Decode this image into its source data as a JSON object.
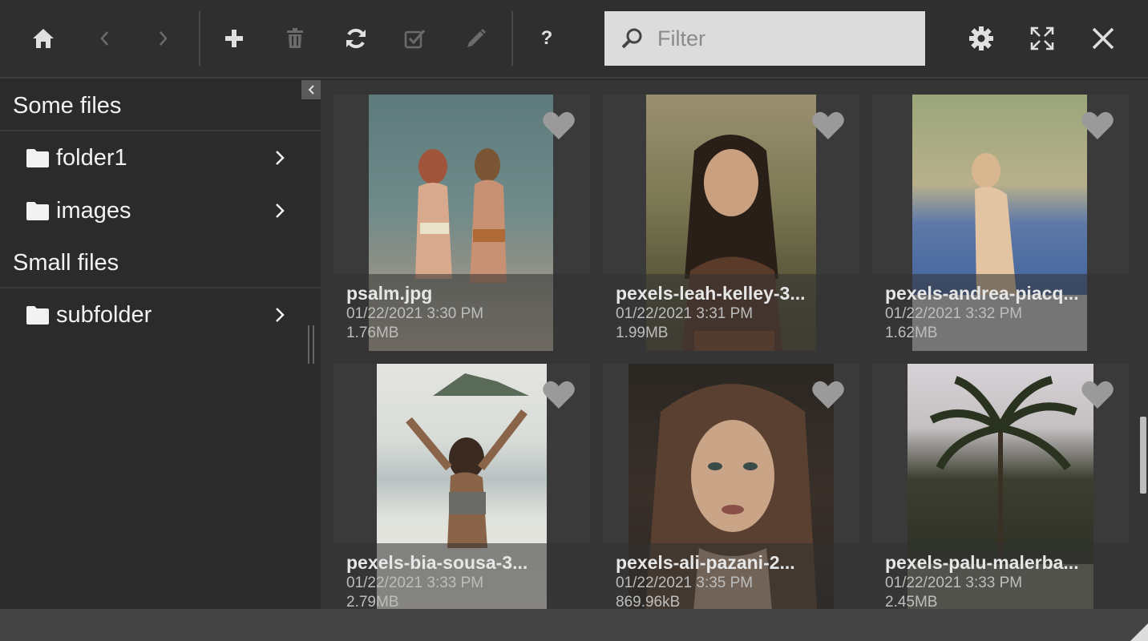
{
  "toolbar": {
    "buttons": [
      {
        "icon": "home-icon"
      },
      {
        "icon": "back-icon"
      },
      {
        "icon": "forward-icon"
      },
      {
        "icon": "add-icon"
      },
      {
        "icon": "trash-icon"
      },
      {
        "icon": "refresh-icon"
      },
      {
        "icon": "select-icon"
      },
      {
        "icon": "rename-icon"
      },
      {
        "icon": "help-icon"
      }
    ],
    "help_label": "?",
    "filter_placeholder": "Filter",
    "filter_value": "",
    "right_buttons": [
      {
        "icon": "settings-icon"
      },
      {
        "icon": "fullscreen-icon"
      },
      {
        "icon": "close-icon"
      }
    ]
  },
  "sidebar": {
    "sections": [
      {
        "title": "Some files",
        "folders": [
          {
            "label": "folder1"
          },
          {
            "label": "images"
          }
        ]
      },
      {
        "title": "Small files",
        "folders": [
          {
            "label": "subfolder"
          }
        ]
      }
    ]
  },
  "files": [
    {
      "name": "psalm.jpg",
      "date": "01/22/2021 3:30 PM",
      "size": "1.76MB",
      "favorited": false
    },
    {
      "name": "pexels-leah-kelley-3...",
      "date": "01/22/2021 3:31 PM",
      "size": "1.99MB",
      "favorited": false
    },
    {
      "name": "pexels-andrea-piacq...",
      "date": "01/22/2021 3:32 PM",
      "size": "1.62MB",
      "favorited": false
    },
    {
      "name": "pexels-bia-sousa-3...",
      "date": "01/22/2021 3:33 PM",
      "size": "2.79MB",
      "favorited": false
    },
    {
      "name": "pexels-ali-pazani-2...",
      "date": "01/22/2021 3:35 PM",
      "size": "869.96kB",
      "favorited": false
    },
    {
      "name": "pexels-palu-malerba...",
      "date": "01/22/2021 3:33 PM",
      "size": "2.45MB",
      "favorited": false
    }
  ],
  "colors": {
    "toolbar_bg": "#2f2f2f",
    "sidebar_bg": "#2b2b2b",
    "grid_bg": "#353535",
    "filter_bg": "#dcdcdc",
    "icon_active": "#e0e0e0",
    "icon_disabled": "#6b6b6b"
  }
}
